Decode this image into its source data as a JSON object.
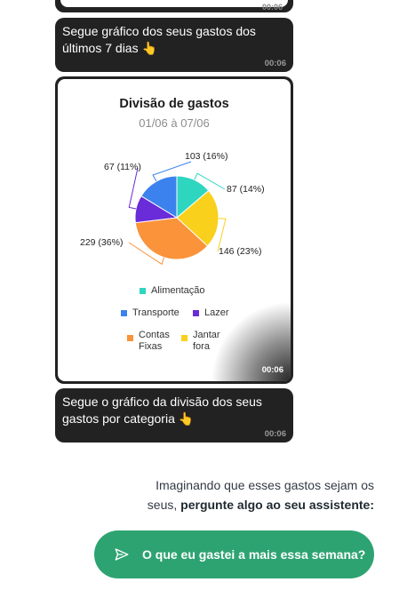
{
  "messages": {
    "prev_time": "00:06",
    "msg1_text": "Segue gráfico dos seus gastos dos últimos 7 dias 👆",
    "msg1_time": "00:06",
    "chart_time": "00:06",
    "msg2_text": "Segue o gráfico da divisão dos seus gastos por categoria 👆",
    "msg2_time": "00:06"
  },
  "chart_data": {
    "type": "pie",
    "title": "Divisão de gastos",
    "subtitle": "01/06 à 07/06",
    "slices": [
      {
        "name": "Alimentação",
        "value": 87,
        "label": "87 (14%)",
        "color": "#2ed6c0"
      },
      {
        "name": "Jantar fora",
        "value": 146,
        "label": "146 (23%)",
        "color": "#f9d01c"
      },
      {
        "name": "Contas Fixas",
        "value": 229,
        "label": "229 (36%)",
        "color": "#fa933a"
      },
      {
        "name": "Lazer",
        "value": 67,
        "label": "67 (11%)",
        "color": "#6a2bd8"
      },
      {
        "name": "Transporte",
        "value": 103,
        "label": "103 (16%)",
        "color": "#3b82ef"
      }
    ],
    "legend": [
      {
        "name": "Alimentação",
        "color": "#2ed6c0"
      },
      {
        "name": "Transporte",
        "color": "#3b82ef"
      },
      {
        "name": "Lazer",
        "color": "#6a2bd8"
      },
      {
        "name": "Contas Fixas",
        "color": "#fa933a"
      },
      {
        "name": "Jantar fora",
        "color": "#f9d01c"
      }
    ]
  },
  "prompt": {
    "line1": "Imaginando que esses gastos sejam os",
    "line2_prefix": "seus, ",
    "line2_bold": "pergunte algo ao seu assistente:"
  },
  "cta": {
    "label": "O que eu gastei a mais essa semana?",
    "icon": "send-icon",
    "color": "#2ea372"
  }
}
